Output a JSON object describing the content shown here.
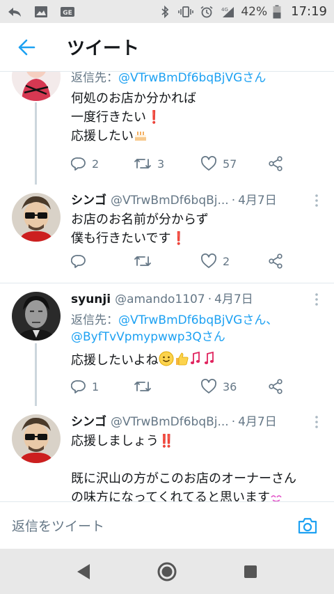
{
  "status_bar": {
    "battery": "42%",
    "time": "17:19",
    "network": "4G"
  },
  "header": {
    "title": "ツイート"
  },
  "tweets": [
    {
      "reply_label": "返信先：",
      "reply_to": "@VTrwBmDf6bqBjVGさん",
      "text": "何処のお店か分かれば\n一度行きたい❗\n応援したい",
      "replies": "2",
      "retweets": "3",
      "likes": "57"
    },
    {
      "name": "シンゴ",
      "handle": "@VTrwBmDf6bqBj...",
      "sep": "·",
      "date": "4月7日",
      "text": "お店のお名前が分からず\n僕も行きたいです❗",
      "replies": "",
      "retweets": "",
      "likes": "2"
    },
    {
      "name": "syunji",
      "handle": "@amando1107",
      "sep": "·",
      "date": "4月7日",
      "reply_label": "返信先：",
      "reply_to": "@VTrwBmDf6bqBjVGさん、",
      "reply_to_2": "@ByfTvVpmypwwp3Qさん",
      "text": "応援したいよね",
      "replies": "1",
      "retweets": "",
      "likes": "36"
    },
    {
      "name": "シンゴ",
      "handle": "@VTrwBmDf6bqBj...",
      "sep": "·",
      "date": "4月7日",
      "text_1": "応援しましょう‼️",
      "text_2": "既に沢山の方がこのお店のオーナーさん\nの味方になってくれてると思います"
    }
  ],
  "reply_bar": {
    "placeholder": "返信をツイート"
  },
  "colors": {
    "accent": "#1da1f2",
    "muted": "#657786",
    "divider": "#e1e8ed",
    "like_red": "#e0245e"
  }
}
